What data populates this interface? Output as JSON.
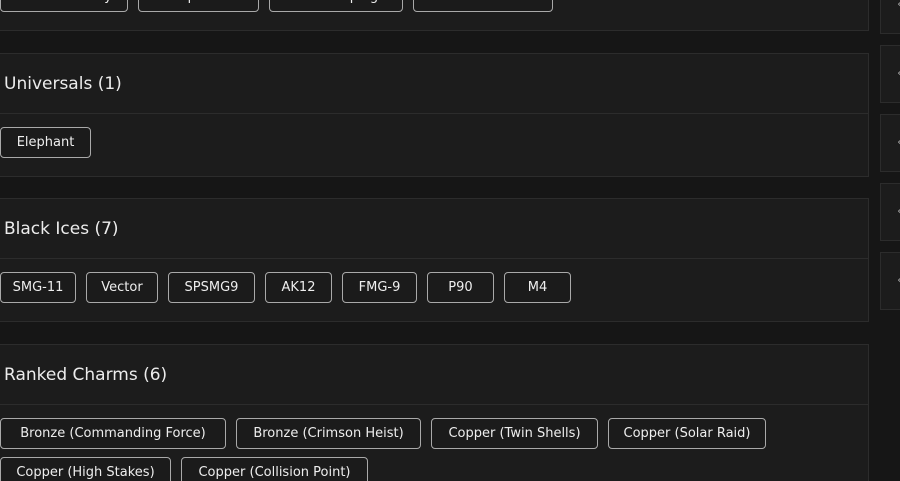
{
  "sections": {
    "top_partial": {
      "items": [
        "Sleek Lethality",
        "Tranquil Seas",
        "Fable Shapings",
        "Lifeblood Flower"
      ]
    },
    "universals": {
      "title": "Universals (1)",
      "items": [
        "Elephant"
      ]
    },
    "black_ices": {
      "title": "Black Ices (7)",
      "items": [
        "SMG-11",
        "Vector",
        "SPSMG9",
        "AK12",
        "FMG-9",
        "P90",
        "M4"
      ]
    },
    "ranked_charms": {
      "title": "Ranked Charms (6)",
      "items": [
        "Bronze (Commanding Force)",
        "Bronze (Crimson Heist)",
        "Copper (Twin Shells)",
        "Copper (Solar Raid)",
        "Copper (High Stakes)",
        "Copper (Collision Point)"
      ]
    }
  },
  "rail": {
    "icons": [
      "expand-icon",
      "expand-icon",
      "expand-icon",
      "expand-icon",
      "expand-icon",
      "expand-icon"
    ]
  }
}
